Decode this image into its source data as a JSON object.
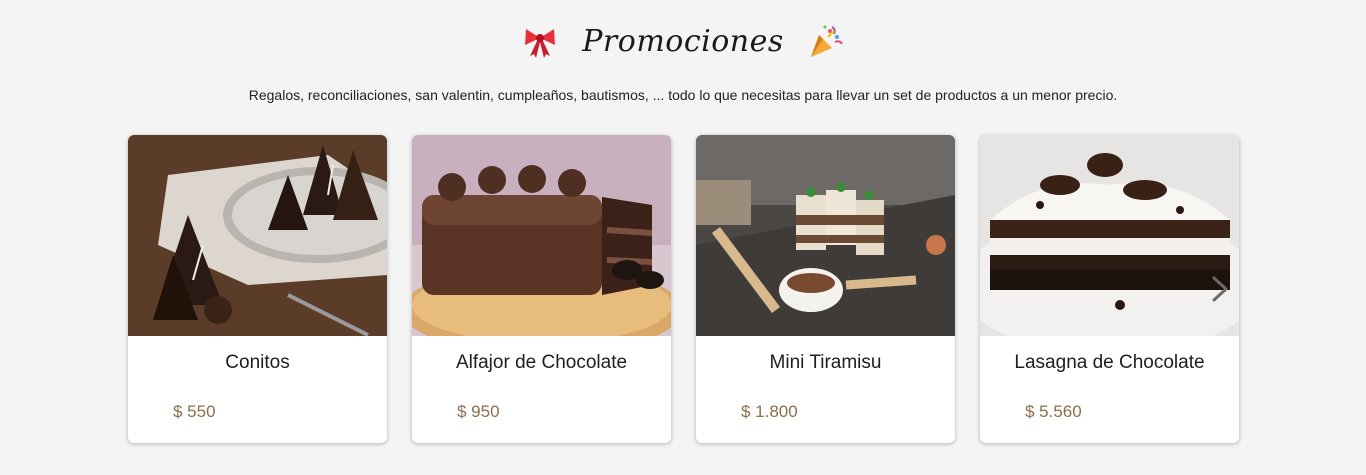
{
  "header": {
    "title": "Promociones",
    "left_icon": "ribbon-bow-icon",
    "right_icon": "party-popper-icon"
  },
  "subtitle": "Regalos, reconciliaciones, san valentin, cumpleaños, bautismos, ... todo lo que necesitas para llevar un set de productos a un menor precio.",
  "products": [
    {
      "name": "Conitos",
      "price": "$ 550",
      "image": "chocolate-cones-photo"
    },
    {
      "name": "Alfajor de Chocolate",
      "price": "$ 950",
      "image": "chocolate-cake-photo"
    },
    {
      "name": "Mini Tiramisu",
      "price": "$ 1.800",
      "image": "mini-tiramisu-photo"
    },
    {
      "name": "Lasagna de Chocolate",
      "price": "$ 5.560",
      "image": "chocolate-lasagna-photo"
    }
  ],
  "carousel": {
    "next_icon": "chevron-right-icon"
  },
  "colors": {
    "background": "#f4f4f4",
    "price": "#8c6d4c",
    "text": "#1e1e1e"
  }
}
